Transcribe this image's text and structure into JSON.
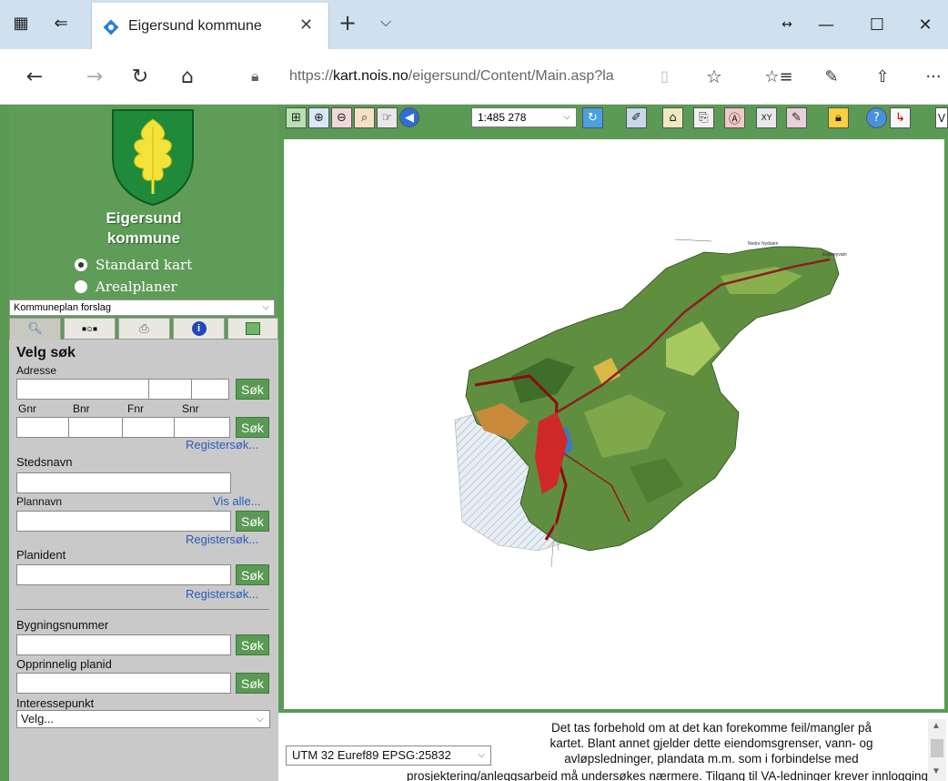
{
  "browser": {
    "tab_title": "Eigersund kommune",
    "tab_close": "✕",
    "new_tab": "+",
    "tab_menu": "⌵",
    "url_prefix": "https://",
    "url_host": "kart.nois.no",
    "url_path": "/eigersund/Content/Main.asp?la",
    "window_resize": "↔",
    "window_min": "—",
    "window_max": "☐",
    "window_close": "✕",
    "nav_back": "←",
    "nav_forward": "→",
    "nav_refresh": "↻",
    "nav_home": "⌂",
    "favorites_icon": "☆",
    "menu_icon": "···"
  },
  "sidebar": {
    "city_line1": "Eigersund",
    "city_line2": "kommune",
    "radio_standard": "Standard kart",
    "radio_areal": "Arealplaner",
    "layer_select": "Kommuneplan forslag"
  },
  "panel": {
    "title": "Velg søk",
    "adresse": "Adresse",
    "gnr": "Gnr",
    "bnr": "Bnr",
    "fnr": "Fnr",
    "snr": "Snr",
    "sok": "Søk",
    "registersok": "Registersøk...",
    "stedsnavn": "Stedsnavn",
    "plannavn": "Plannavn",
    "vis_alle": "Vis alle...",
    "planident": "Planident",
    "bygningsnummer": "Bygningsnummer",
    "opprinnelig": "Opprinnelig planid",
    "interessepunkt": "Interessepunkt",
    "velg": "Velg..."
  },
  "toolbar": {
    "scale": "1:485 278"
  },
  "map": {
    "label_north": "Nedre Nydalen",
    "label_east": "Eigerøyvatn"
  },
  "footer": {
    "coord_system": "UTM 32 Euref89 EPSG:25832",
    "disclaimer_l1": "Det tas forbehold om at det kan forekomme feil/mangler på",
    "disclaimer_l2": "kartet. Blant annet gjelder dette eiendomsgrenser, vann- og",
    "disclaimer_l3": "avløpsledninger, plandata m.m. som i forbindelse med",
    "disclaimer_l4": "prosjektering/anleggsarbeid må undersøkes nærmere. Tilgang til VA-ledninger krever innlogging"
  }
}
